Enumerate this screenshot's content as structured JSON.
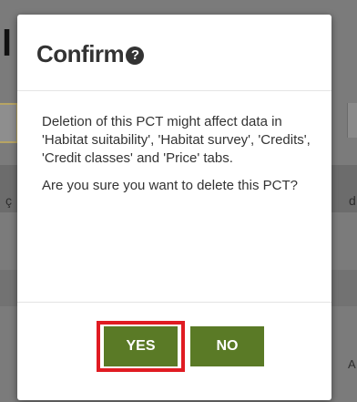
{
  "background": {
    "heading_fragment": "l",
    "glyph_left": "ç",
    "glyph_right": "d",
    "glyph_bottom_right": "A"
  },
  "modal": {
    "title": "Confirm",
    "help_icon_glyph": "?",
    "message_1": "Deletion of this PCT might affect data in 'Habitat suitability', 'Habitat survey', 'Credits', 'Credit classes' and 'Price' tabs.",
    "message_2": "Are you sure you want to delete this PCT?",
    "yes_label": "YES",
    "no_label": "NO"
  },
  "colors": {
    "button_green": "#5a7a26",
    "highlight_red": "#e01b22",
    "overlay_gray": "#7b7b7b"
  }
}
